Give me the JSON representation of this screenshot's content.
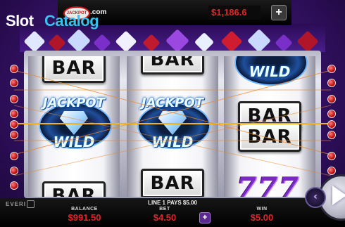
{
  "watermark": {
    "logo_slot": "Slot",
    "logo_catalog": "Catalog",
    "logo_com": ".com",
    "logo_badge": "JACKPOT"
  },
  "header": {
    "cash_display": "$1,186.6",
    "add_funds_label": "+"
  },
  "reels": {
    "reel1": {
      "top": "BAR",
      "middle_line1": "JACKPOT",
      "middle_line2": "WILD",
      "bottom": "BAR"
    },
    "reel2": {
      "top": "BAR",
      "middle_line1": "JACKPOT",
      "middle_line2": "WILD",
      "bottom": "BAR"
    },
    "reel3": {
      "top": "WILD",
      "middle_line1": "BAR",
      "middle_line2": "BAR",
      "bottom": "7"
    }
  },
  "bottom_bar": {
    "provider": "EVERI",
    "line_pays": "LINE 1 PAYS $5.00",
    "balance_label": "BALANCE",
    "balance_value": "$991.50",
    "bet_label": "BET",
    "bet_value": "$4.50",
    "bet_plus": "+",
    "win_label": "WIN",
    "win_value": "$5.00"
  },
  "controls": {
    "prev_arrow": "‹"
  },
  "colors": {
    "accent_red": "#e2232a",
    "purple_bg": "#3a1470",
    "payline_orange": "#e8882a"
  }
}
